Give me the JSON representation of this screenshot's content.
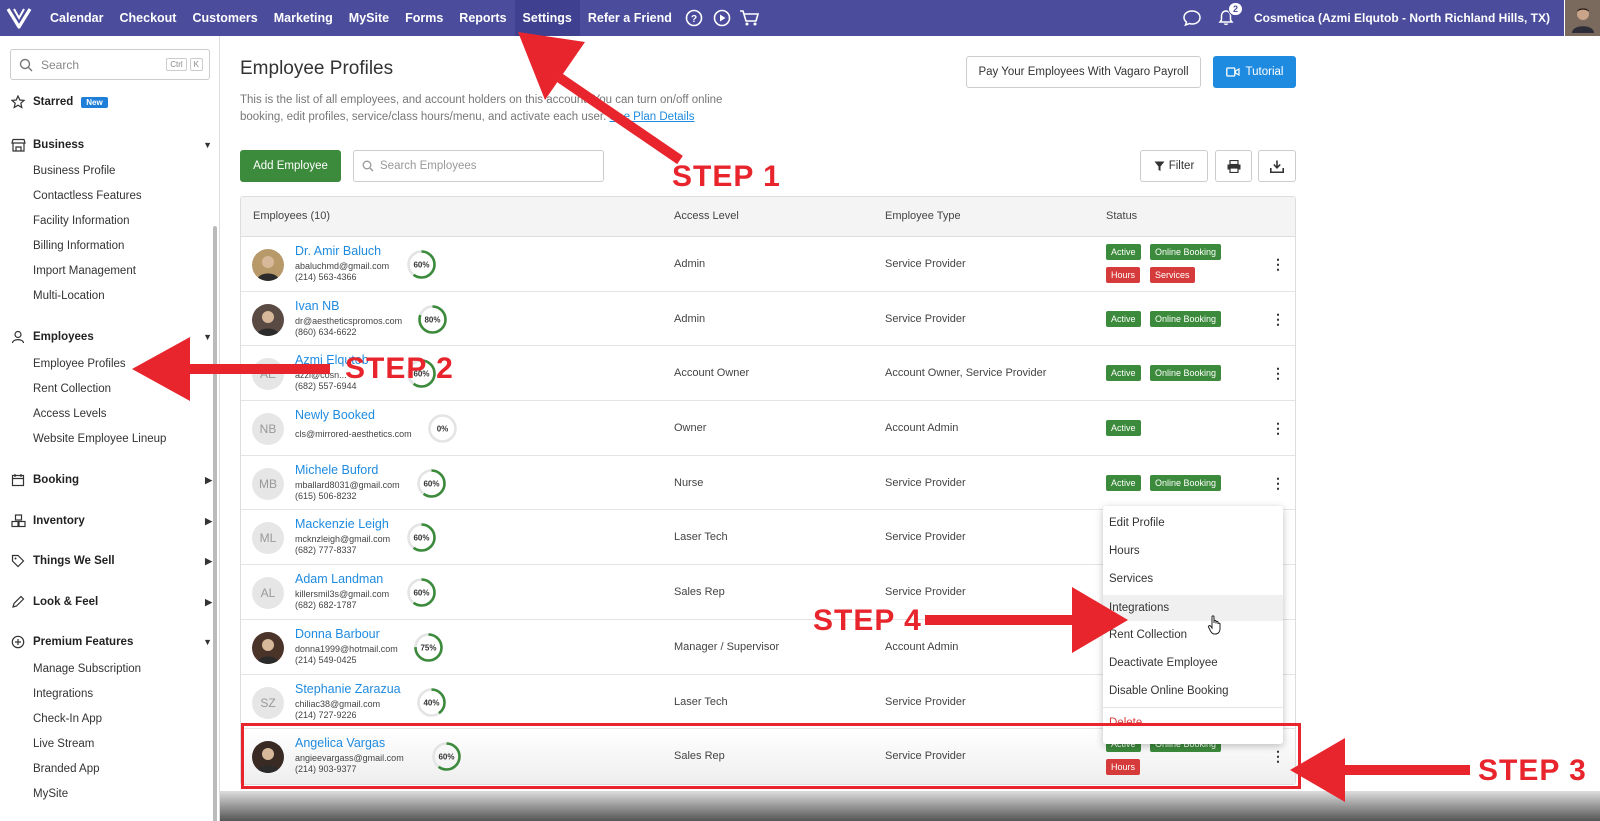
{
  "topnav": {
    "items": [
      "Calendar",
      "Checkout",
      "Customers",
      "Marketing",
      "MySite",
      "Forms",
      "Reports",
      "Settings",
      "Refer a Friend"
    ],
    "active": "Settings",
    "notification_count": "2",
    "business": "Cosmetica (Azmi Elqutob - North Richland Hills, TX)"
  },
  "sidebar": {
    "search_placeholder": "Search",
    "kbd1": "Ctrl",
    "kbd2": "K",
    "starred": "Starred",
    "new_tag": "New",
    "business": "Business",
    "business_items": [
      "Business Profile",
      "Contactless Features",
      "Facility Information",
      "Billing Information",
      "Import Management",
      "Multi-Location"
    ],
    "employees": "Employees",
    "employees_items": [
      "Employee Profiles",
      "Rent Collection",
      "Access Levels",
      "Website Employee Lineup"
    ],
    "booking": "Booking",
    "inventory": "Inventory",
    "things": "Things We Sell",
    "look": "Look & Feel",
    "premium": "Premium Features",
    "premium_items": [
      "Manage Subscription",
      "Integrations",
      "Check-In App",
      "Live Stream",
      "Branded App",
      "MySite"
    ]
  },
  "page": {
    "title": "Employee Profiles",
    "desc_1": "This is the list of all employees, and account holders on this account. You can turn on/off online booking, edit profiles, service/class hours/menu, and activate each user.",
    "desc_link": "See Plan Details",
    "payroll_btn": "Pay Your Employees With Vagaro Payroll",
    "tutorial_btn": "Tutorial",
    "add_btn": "Add Employee",
    "search_placeholder": "Search Employees",
    "filter_btn": "Filter"
  },
  "table": {
    "headers": [
      "Employees (10)",
      "Access Level",
      "Employee Type",
      "Status"
    ],
    "rows": [
      {
        "initials": "",
        "name": "Dr. Amir Baluch",
        "email": "abaluchmd@gmail.com",
        "phone": "(214) 563-4366",
        "pct": "60%",
        "access": "Admin",
        "type": "Service Provider",
        "tags": [
          "Active",
          "Online Booking",
          "Hours",
          "Services"
        ]
      },
      {
        "initials": "",
        "name": "Ivan NB",
        "email": "dr@aestheticspromos.com",
        "phone": "(860) 634-6622",
        "pct": "80%",
        "access": "Admin",
        "type": "Service Provider",
        "tags": [
          "Active",
          "Online Booking"
        ]
      },
      {
        "initials": "AE",
        "name": "Azmi Elqutob",
        "email": "azzi@cosn...",
        "phone": "(682) 557-6944",
        "pct": "60%",
        "access": "Account Owner",
        "type": "Account Owner, Service Provider",
        "tags": [
          "Active",
          "Online Booking"
        ]
      },
      {
        "initials": "NB",
        "name": "Newly Booked",
        "email": "cls@mirrored-aesthetics.com",
        "phone": "",
        "pct": "0%",
        "access": "Owner",
        "type": "Account Admin",
        "tags": [
          "Active"
        ]
      },
      {
        "initials": "MB",
        "name": "Michele Buford",
        "email": "mballard8031@gmail.com",
        "phone": "(615) 506-8232",
        "pct": "60%",
        "access": "Nurse",
        "type": "Service Provider",
        "tags": [
          "Active",
          "Online Booking"
        ]
      },
      {
        "initials": "ML",
        "name": "Mackenzie Leigh",
        "email": "mcknzleigh@gmail.com",
        "phone": "(682) 777-8337",
        "pct": "60%",
        "access": "Laser Tech",
        "type": "Service Provider",
        "tags": []
      },
      {
        "initials": "AL",
        "name": "Adam Landman",
        "email": "killersmil3s@gmail.com",
        "phone": "(682) 682-1787",
        "pct": "60%",
        "access": "Sales Rep",
        "type": "Service Provider",
        "tags": []
      },
      {
        "initials": "",
        "name": "Donna Barbour",
        "email": "donna1999@hotmail.com",
        "phone": "(214) 549-0425",
        "pct": "75%",
        "access": "Manager / Supervisor",
        "type": "Account Admin",
        "tags": []
      },
      {
        "initials": "SZ",
        "name": "Stephanie Zarazua",
        "email": "chiliac38@gmail.com",
        "phone": "(214) 727-9226",
        "pct": "40%",
        "access": "Laser Tech",
        "type": "Service Provider",
        "tags": []
      },
      {
        "initials": "",
        "name": "Angelica Vargas",
        "email": "angieevargass@gmail.com",
        "phone": "(214) 903-9377",
        "pct": "60%",
        "access": "Sales Rep",
        "type": "Service Provider",
        "tags": [
          "Active",
          "Online Booking",
          "Hours"
        ]
      }
    ]
  },
  "menu": {
    "items": [
      "Edit Profile",
      "Hours",
      "Services",
      "Integrations",
      "Rent Collection",
      "Deactivate Employee",
      "Disable Online Booking",
      "Delete"
    ]
  },
  "annotations": {
    "step1": "STEP 1",
    "step2": "STEP 2",
    "step3": "STEP 3",
    "step4": "STEP 4"
  }
}
